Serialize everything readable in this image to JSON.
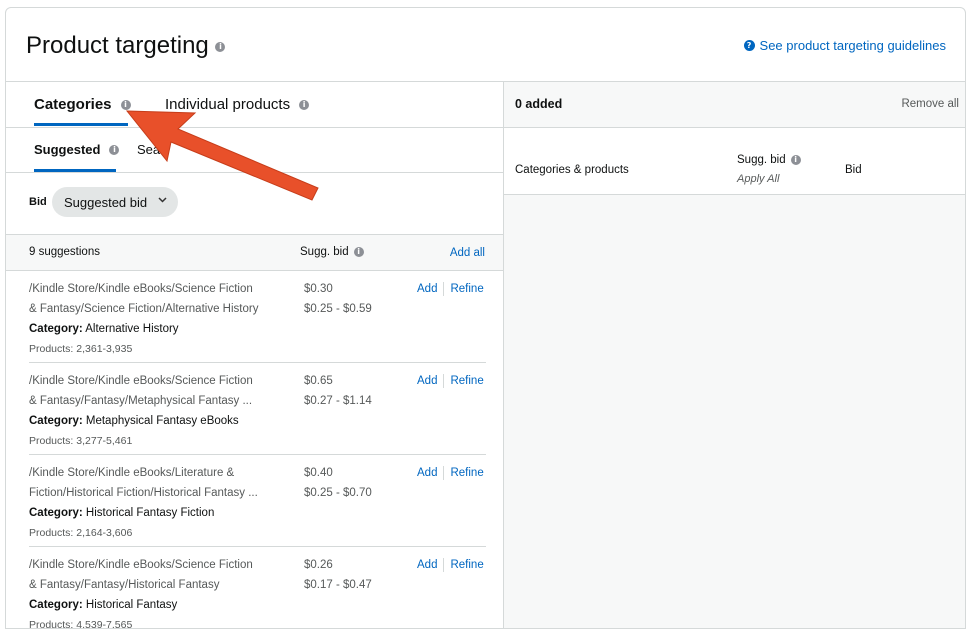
{
  "header": {
    "title": "Product targeting",
    "guidelines_link": "See product targeting guidelines"
  },
  "tabs": [
    {
      "label": "Categories",
      "active": true
    },
    {
      "label": "Individual products",
      "active": false
    }
  ],
  "subtabs": [
    {
      "label": "Suggested",
      "active": true
    },
    {
      "label": "Sea",
      "active": false
    }
  ],
  "bid": {
    "label": "Bid",
    "selected": "Suggested bid"
  },
  "suggestions": {
    "count_label": "9 suggestions",
    "sugg_bid_label": "Sugg. bid",
    "add_all": "Add all",
    "add_label": "Add",
    "refine_label": "Refine",
    "category_prefix": "Category:",
    "items": [
      {
        "path_line1": "/Kindle Store/Kindle eBooks/Science Fiction",
        "path_line2": "& Fantasy/Science Fiction/Alternative History",
        "category": "Alternative History",
        "products": "Products: 2,361-3,935",
        "bid": "$0.30",
        "range": "$0.25 - $0.59"
      },
      {
        "path_line1": "/Kindle Store/Kindle eBooks/Science Fiction",
        "path_line2": "& Fantasy/Fantasy/Metaphysical Fantasy ...",
        "category": "Metaphysical Fantasy eBooks",
        "products": "Products: 3,277-5,461",
        "bid": "$0.65",
        "range": "$0.27 - $1.14"
      },
      {
        "path_line1": "/Kindle Store/Kindle eBooks/Literature &",
        "path_line2": "Fiction/Historical Fiction/Historical Fantasy ...",
        "category": "Historical Fantasy Fiction",
        "products": "Products: 2,164-3,606",
        "bid": "$0.40",
        "range": "$0.25 - $0.70"
      },
      {
        "path_line1": "/Kindle Store/Kindle eBooks/Science Fiction",
        "path_line2": "& Fantasy/Fantasy/Historical Fantasy",
        "category": "Historical Fantasy",
        "products": "Products: 4,539-7,565",
        "bid": "$0.26",
        "range": "$0.17 - $0.47"
      }
    ]
  },
  "added_panel": {
    "count_label": "0 added",
    "remove_all": "Remove all",
    "col_categories": "Categories & products",
    "col_sugg_bid": "Sugg. bid",
    "apply_all": "Apply All",
    "col_bid": "Bid"
  },
  "colors": {
    "accent": "#0066c0",
    "annotation_arrow": "#e8502a"
  }
}
